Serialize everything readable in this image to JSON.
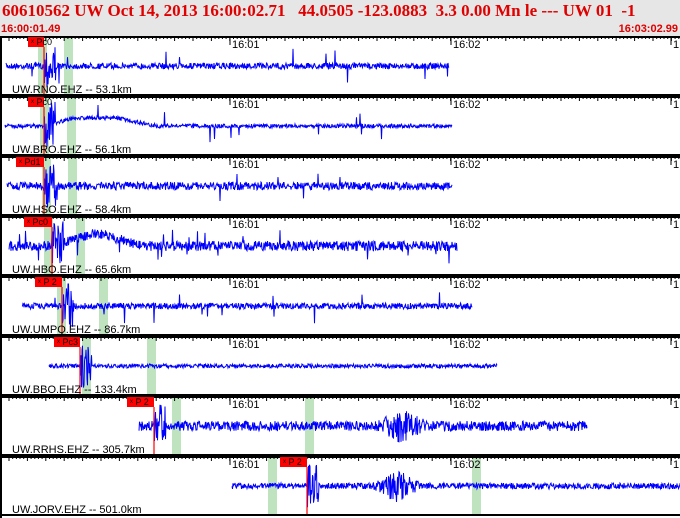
{
  "header": {
    "title": "60610562 UW Oct 14, 2013 16:00:02.71   44.0505 -123.0883  3.3 0.00 Mn le --- UW 01  -1",
    "start_time": "16:00:01.49",
    "end_time": "16:03:02.99"
  },
  "time_ticks": [
    "16:01",
    "16:02",
    "1"
  ],
  "colors": {
    "trace": "#0000ff",
    "pick": "#ff0000",
    "window": "#bfe3bf",
    "header_text": "#e00000"
  },
  "panels": [
    {
      "station": "UW.RNO.EHZ -- 53.1km",
      "pick": "ˣ Pc0"
    },
    {
      "station": "UW.BRO.EHZ -- 56.1km",
      "pick": "ˣ Pc0"
    },
    {
      "station": "UW.HSO.EHZ -- 58.4km",
      "pick": "ˣ Pd1"
    },
    {
      "station": "UW.HBO.EHZ -- 65.6km",
      "pick": "ˣ Pc0"
    },
    {
      "station": "UW.UMPQ.EHZ -- 86.7km",
      "pick": "ˣ P 2"
    },
    {
      "station": "UW.BBO.EHZ -- 133.4km",
      "pick": "ˣ Pc3"
    },
    {
      "station": "UW.RRHS.EHZ -- 305.7km",
      "pick": "ˣ P 2"
    },
    {
      "station": "UW.JORV.EHZ -- 501.0km",
      "pick": "ˣ P 2"
    }
  ]
}
